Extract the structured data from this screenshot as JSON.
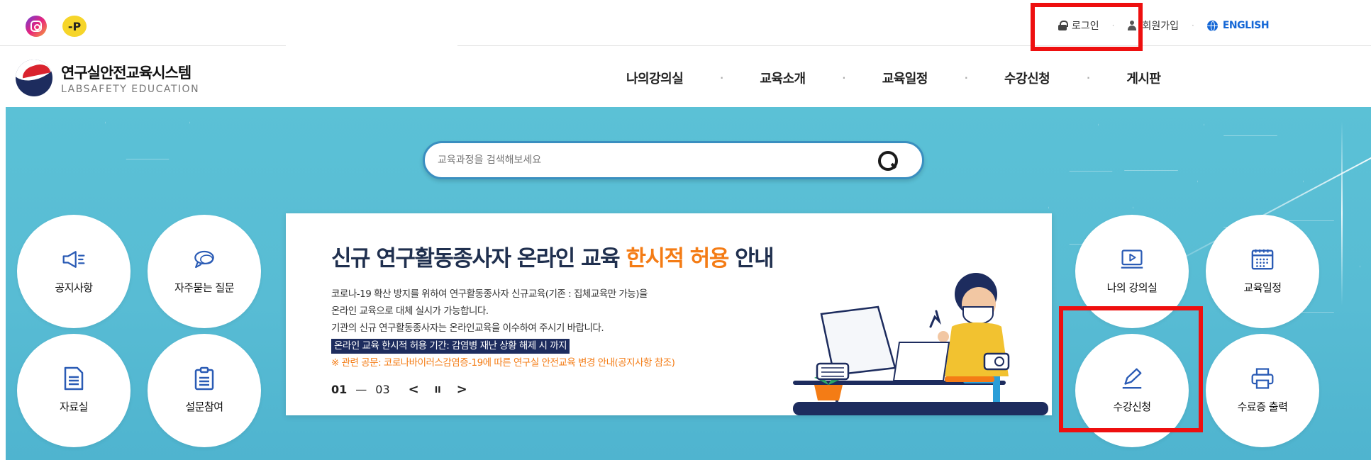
{
  "social": {
    "instagram_icon": "instagram-icon",
    "p_badge_label": "-P"
  },
  "util_nav": {
    "login": "로그인",
    "signup": "회원가입",
    "english": "ENGLISH"
  },
  "logo": {
    "title_ko": "연구실안전교육시스템",
    "title_en": "LABSAFETY EDUCATION"
  },
  "gnb": [
    "나의강의실",
    "교육소개",
    "교육일정",
    "수강신청",
    "게시판"
  ],
  "search": {
    "placeholder": "교육과정을 검색해보세요"
  },
  "quick_left": [
    {
      "label": "공지사항",
      "icon": "megaphone-icon"
    },
    {
      "label": "자주묻는 질문",
      "icon": "chat-bubbles-icon"
    },
    {
      "label": "자료실",
      "icon": "document-icon"
    },
    {
      "label": "설문참여",
      "icon": "clipboard-icon"
    }
  ],
  "quick_right": [
    {
      "label": "나의 강의실",
      "icon": "play-screen-icon"
    },
    {
      "label": "교육일정",
      "icon": "calendar-icon"
    },
    {
      "label": "수강신청",
      "icon": "pencil-icon"
    },
    {
      "label": "수료증 출력",
      "icon": "printer-icon"
    }
  ],
  "banner": {
    "title_pre": "신규 연구활동종사자 온라인 교육 ",
    "title_highlight": "한시적 허용",
    "title_post": " 안내",
    "line1": "코로나-19 확산 방지를 위하여 연구활동종사자 신규교육(기존 : 집체교육만 가능)을",
    "line2": "온라인 교육으로 대체 실시가 가능합니다.",
    "line3": "기관의 신규 연구활동종사자는 온라인교육을 이수하여 주시기 바랍니다.",
    "period": "온라인 교육 한시적 허용 기간: 감염병 재난 상황 해제 시 까지",
    "note": "※ 관련 공문: 코로나바이러스감염증-19에 따른 연구실 안전교육 변경 안내(공지사항 참조)",
    "pager_current": "01",
    "pager_sep": "—",
    "pager_total": "03",
    "prev": "<",
    "pause": "II",
    "next": ">"
  },
  "colors": {
    "hero_bg": "#58bcd4",
    "accent_orange": "#f47c15",
    "navy": "#1d2c5e",
    "highlight_red": "#ee0f0f",
    "icon_blue": "#2a5bb5"
  }
}
